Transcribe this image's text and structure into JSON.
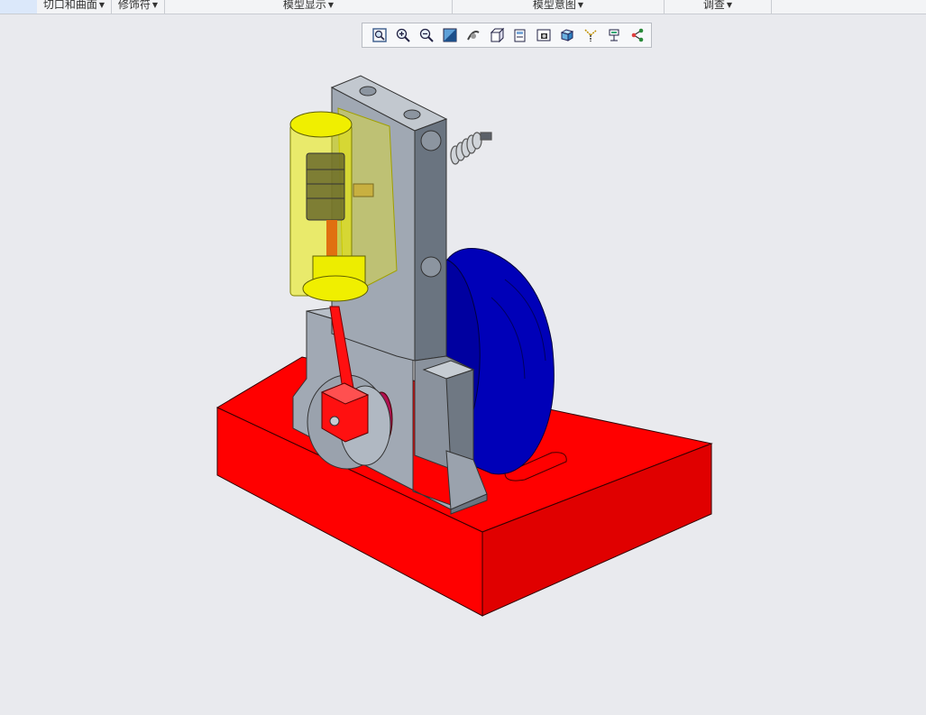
{
  "ribbon": {
    "groups": [
      {
        "label": "切口和曲面",
        "name": "group-cut-surface"
      },
      {
        "label": "修饰符",
        "name": "group-modifiers"
      },
      {
        "label": "模型显示",
        "name": "group-model-display"
      },
      {
        "label": "模型意图",
        "name": "group-model-intent"
      },
      {
        "label": "调查",
        "name": "group-investigate"
      }
    ]
  },
  "graphics_toolbar": {
    "buttons": [
      {
        "name": "refit-icon"
      },
      {
        "name": "zoom-in-icon"
      },
      {
        "name": "zoom-out-icon"
      },
      {
        "name": "repaint-icon"
      },
      {
        "name": "reorient-icon"
      },
      {
        "name": "saved-orientations-icon"
      },
      {
        "name": "view-manager-icon"
      },
      {
        "name": "perspective-view-icon"
      },
      {
        "name": "display-style-icon"
      },
      {
        "name": "datum-display-icon"
      },
      {
        "name": "spin-center-icon"
      },
      {
        "name": "annotation-display-icon"
      }
    ]
  },
  "colors": {
    "base": "#ff0000",
    "frame": "#98a1ad",
    "cylinder": "#f0ef00",
    "flywheel": "#0000b0",
    "rod": "#ff1010"
  }
}
